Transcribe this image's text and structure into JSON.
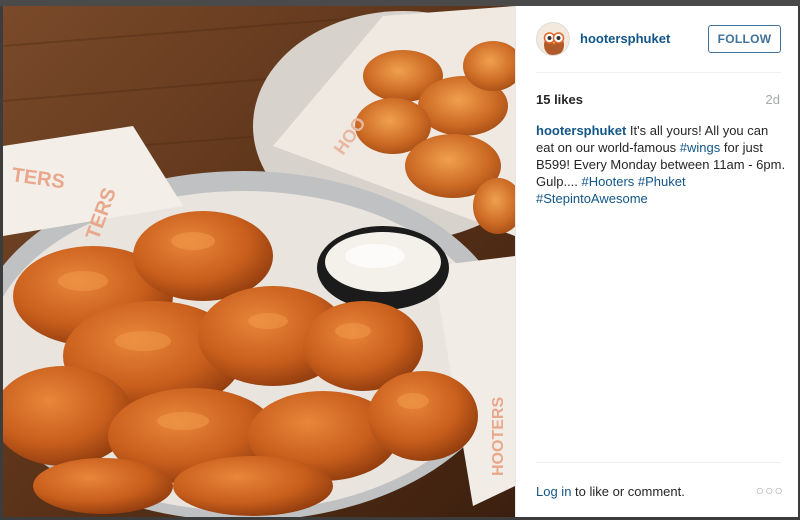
{
  "post": {
    "username": "hootersphuket",
    "follow_label": "FOLLOW",
    "likes": "15 likes",
    "age": "2d",
    "caption": {
      "t1": " It's all yours! All you can eat on our world-famous ",
      "tag_wings": "#wings",
      "t2": " for just B599! Every Monday between 11am - 6pm. Gulp.... ",
      "tag_hooters": "#Hooters",
      "tag_phuket": "#Phuket",
      "tag_stepinto": "#StepintoAwesome"
    },
    "login_link": "Log in",
    "login_rest": " to like or comment.",
    "more": "○○○",
    "photo_paper_text": {
      "top": "TERS",
      "side": "TERS",
      "right_a": "HOO",
      "right_b": "HOOTERS"
    }
  },
  "icons": {
    "avatar": "owl-logo-icon",
    "more": "more-options-icon"
  },
  "colors": {
    "link": "#125688",
    "follow": "#3f729b",
    "muted": "#a5a7aa"
  }
}
